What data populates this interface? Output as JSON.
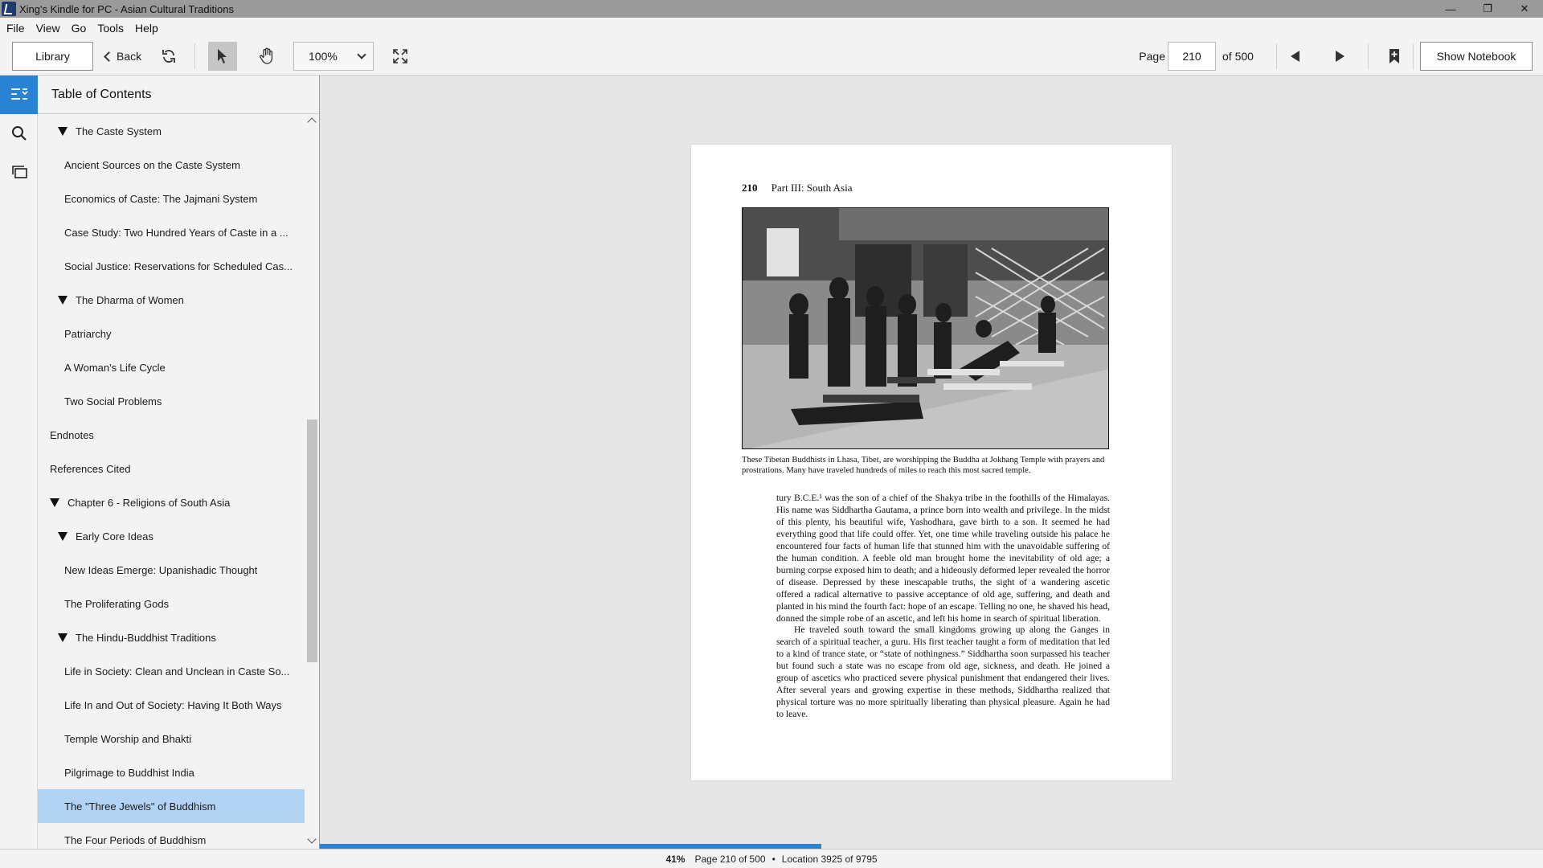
{
  "window": {
    "title": "Xing's Kindle for PC - Asian Cultural Traditions",
    "minimize": "—",
    "maximize": "❐",
    "close": "✕"
  },
  "menu": [
    "File",
    "View",
    "Go",
    "Tools",
    "Help"
  ],
  "toolbar": {
    "library_label": "Library",
    "back_label": "Back",
    "zoom_value": "100%",
    "page_label": "Page",
    "page_value": "210",
    "page_total": "of 500",
    "notebook_label": "Show Notebook"
  },
  "toc": {
    "header": "Table of Contents",
    "items": [
      {
        "label": "The Caste System",
        "level": 2,
        "expanded": true
      },
      {
        "label": "Ancient Sources on the Caste System",
        "level": 3
      },
      {
        "label": "Economics of Caste: The Jajmani System",
        "level": 3
      },
      {
        "label": "Case Study: Two Hundred Years of Caste in a ...",
        "level": 3
      },
      {
        "label": "Social Justice: Reservations for Scheduled Cas...",
        "level": 3
      },
      {
        "label": "The Dharma of Women",
        "level": 2,
        "expanded": true
      },
      {
        "label": "Patriarchy",
        "level": 3
      },
      {
        "label": "A Woman's Life Cycle",
        "level": 3
      },
      {
        "label": "Two Social Problems",
        "level": 3
      },
      {
        "label": "Endnotes",
        "level": 1
      },
      {
        "label": "References Cited",
        "level": 1
      },
      {
        "label": "Chapter 6 - Religions of South Asia",
        "level": 0,
        "expanded": true
      },
      {
        "label": "Early Core Ideas",
        "level": 2,
        "expanded": true
      },
      {
        "label": "New Ideas Emerge: Upanishadic Thought",
        "level": 3
      },
      {
        "label": "The Proliferating Gods",
        "level": 3
      },
      {
        "label": "The Hindu-Buddhist Traditions",
        "level": 2,
        "expanded": true
      },
      {
        "label": "Life in Society: Clean and Unclean in Caste So...",
        "level": 3
      },
      {
        "label": "Life In and Out of Society: Having It Both Ways",
        "level": 3
      },
      {
        "label": "Temple Worship and Bhakti",
        "level": 3
      },
      {
        "label": "Pilgrimage to Buddhist India",
        "level": 3
      },
      {
        "label": "The \"Three Jewels\" of Buddhism",
        "level": 3,
        "selected": true
      },
      {
        "label": "The Four Periods of Buddhism",
        "level": 3
      }
    ]
  },
  "page": {
    "number": "210",
    "running_head": "Part III: South Asia",
    "caption": "These Tibetan Buddhists in Lhasa, Tibet, are worshipping the Buddha at Jokhang Temple with prayers and prostrations. Many have traveled hundreds of miles to reach this most sacred temple.",
    "paragraph1": "tury B.C.E.¹ was the son of a chief of the Shakya tribe in the foothills of the Himalayas. His name was Siddhartha Gautama, a prince born into wealth and privilege. In the midst of this plenty, his beautiful wife, Yashodhara, gave birth to a son. It seemed he had everything good that life could offer. Yet, one time while traveling outside his palace he encountered four facts of human life that stunned him with the unavoidable suffering of the human condition. A feeble old man brought home the inevitability of old age; a burning corpse exposed him to death; and a hideously deformed leper revealed the horror of disease. Depressed by these inescapable truths, the sight of a wandering ascetic offered a radical alternative to passive acceptance of old age, suffering, and death and planted in his mind the fourth fact: hope of an escape. Telling no one, he shaved his head, donned the simple robe of an ascetic, and left his home in search of spiritual liberation.",
    "paragraph2": "He traveled south toward the small kingdoms growing up along the Ganges in search of a spiritual teacher, a guru. His first teacher taught a form of meditation that led to a kind of trance state, or “state of nothingness.” Siddhartha soon surpassed his teacher but found such a state was no escape from old age, sickness, and death. He joined a group of ascetics who practiced severe physical punishment that endangered their lives. After several years and growing expertise in these methods, Siddhartha realized that physical torture was no more spiritually liberating than physical pleasure. Again he had to leave."
  },
  "progress": {
    "fraction": 0.41
  },
  "status": {
    "percent": "41%",
    "page": "Page 210 of 500",
    "separator": "•",
    "location": "Location 3925 of 9795"
  },
  "icons": {
    "select": "arrow-cursor-icon",
    "hand": "hand-icon",
    "refresh": "refresh-icon",
    "fullscreen": "fullscreen-icon",
    "bookmark": "bookmark-add-icon",
    "toc": "toc-icon",
    "search": "search-icon",
    "flashcards": "flashcards-icon"
  },
  "colors": {
    "accent": "#2a82d4",
    "selection": "#b3d3f5"
  }
}
